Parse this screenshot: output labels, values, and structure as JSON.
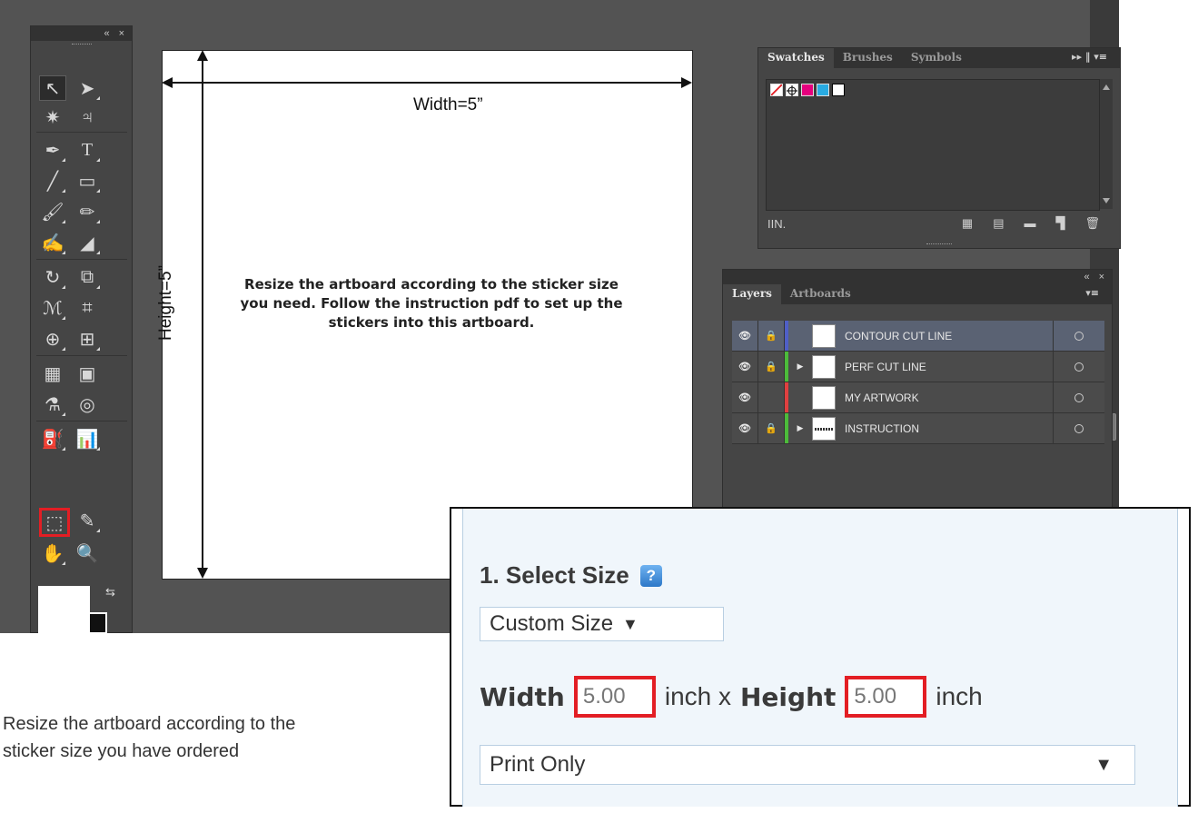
{
  "toolpanel": {
    "collapse_glyph": "«",
    "close_glyph": "×"
  },
  "artboard": {
    "width_label": "Width=5”",
    "height_label": "Height=5”",
    "instruction": "Resize the artboard according to the sticker size you need. Follow the instruction pdf to set up the stickers into this artboard."
  },
  "swatches_panel": {
    "tabs": [
      "Swatches",
      "Brushes",
      "Symbols"
    ],
    "active_tab": "Swatches",
    "swatch_colors": [
      "#ffffff",
      "#ffffff",
      "#e6007e",
      "#29abe2",
      "#ffffff"
    ],
    "library_glyph": "IIN.",
    "menu_glyph": "▸▸ ‖ ▾≡"
  },
  "layers_panel": {
    "tabs": [
      "Layers",
      "Artboards"
    ],
    "active_tab": "Layers",
    "layers": [
      {
        "name": "CONTOUR CUT LINE",
        "locked": true,
        "expandable": false,
        "color": "#4f5fc7",
        "selected": true
      },
      {
        "name": "PERF CUT LINE",
        "locked": true,
        "expandable": true,
        "color": "#4cbb3a",
        "selected": false
      },
      {
        "name": "MY ARTWORK",
        "locked": false,
        "expandable": false,
        "color": "#e04040",
        "selected": false
      },
      {
        "name": "INSTRUCTION",
        "locked": true,
        "expandable": true,
        "color": "#4cbb3a",
        "selected": false
      }
    ]
  },
  "select_size": {
    "title": "1. Select Size",
    "help_glyph": "?",
    "size_option": "Custom Size",
    "width_label": "Width",
    "width_value": "5.00",
    "unit_x": "inch x",
    "height_label": "Height",
    "height_value": "5.00",
    "unit": "inch",
    "print_option": "Print Only"
  },
  "caption": "Resize the artboard according to the sticker size you have ordered"
}
